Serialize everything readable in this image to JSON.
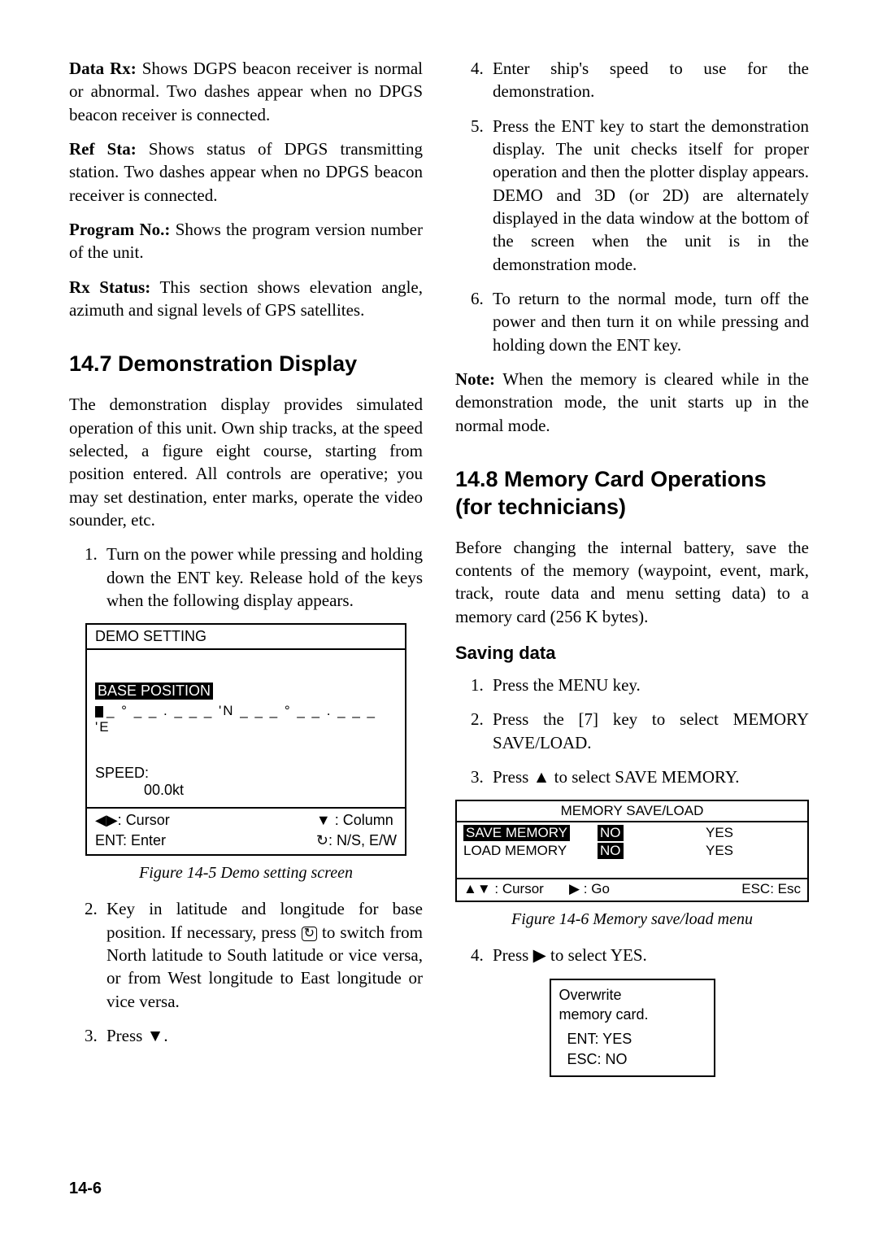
{
  "left": {
    "defs": [
      {
        "term": "Data Rx:",
        "text": " Shows DGPS beacon receiver is normal or abnormal. Two dashes appear when no DPGS beacon receiver is connected."
      },
      {
        "term": "Ref Sta:",
        "text": " Shows status of DPGS transmitting station. Two dashes appear when no DPGS beacon receiver is connected."
      },
      {
        "term": "Program No.:",
        "text": " Shows the program version number of the unit."
      },
      {
        "term": "Rx Status:",
        "text": " This section shows elevation angle, azimuth and signal levels of GPS satellites."
      }
    ],
    "section147": {
      "heading": "14.7 Demonstration Display",
      "intro": "The demonstration display provides simulated operation of this unit. Own ship tracks, at the speed selected, a figure eight course, starting from position entered. All controls are operative; you may set destination, enter marks, operate the video sounder, etc.",
      "steps": [
        "Turn on the power while pressing and holding down the ENT key. Release hold of the keys when the following display appears."
      ],
      "demoBox": {
        "title": "DEMO SETTING",
        "basePosLabel": "BASE POSITION",
        "posLine": "_ ° _ _ . _ _ _ 'N  _ _ _ ° _ _ . _ _ _ 'E",
        "speedLabel": "SPEED:",
        "speedValue": "00.0kt",
        "footer": {
          "leftTop": "◀▶: Cursor",
          "leftBottom": "ENT: Enter",
          "rightTop": "▼ : Column",
          "rightBottom": "↻: N/S, E/W"
        }
      },
      "figCaption": "Figure 14-5 Demo setting screen",
      "step2_a": "Key in latitude and longitude for base position. If necessary, press ",
      "step2_key": "↻",
      "step2_b": " to switch from North latitude to South latitude or vice versa, or from West longitude to East longitude or vice versa.",
      "step3": "Press ▼."
    }
  },
  "right": {
    "steps_cont": [
      "Enter ship's speed to use for the demonstration.",
      "Press the ENT key to start the demonstration display. The unit checks itself for proper operation and then the plotter display appears. DEMO and 3D (or 2D) are alternately displayed in the data window at the bottom of the screen when the unit is in the demonstration mode.",
      "To return to the normal mode, turn off the power and then turn it on while pressing and holding down the ENT key."
    ],
    "note": {
      "term": "Note:",
      "text": " When the memory is cleared while in the demonstration mode, the unit starts up in the normal mode."
    },
    "section148": {
      "heading": "14.8 Memory Card Operations (for technicians)",
      "intro": "Before changing the internal battery, save the contents of the memory (waypoint, event, mark, track, route data and menu setting data) to a memory card (256 K bytes).",
      "subheading": "Saving data",
      "steps": [
        "Press the MENU key.",
        "Press the [7] key to select MEMORY SAVE/LOAD.",
        "Press ▲ to select SAVE MEMORY."
      ],
      "memBox": {
        "title": "MEMORY SAVE/LOAD",
        "row1": {
          "label": "SAVE MEMORY",
          "opt1": "NO",
          "opt2": "YES"
        },
        "row2": {
          "label": "LOAD MEMORY",
          "opt1": "NO",
          "opt2": "YES"
        },
        "footer": {
          "c1": "▲▼ : Cursor",
          "c2": "▶ : Go",
          "c3": "ESC: Esc"
        }
      },
      "figCaption": "Figure 14-6 Memory save/load menu",
      "step4": "Press ▶ to select YES.",
      "overBox": {
        "line1": "Overwrite",
        "line2": "memory card.",
        "ent": "ENT: YES",
        "esc": "ESC: NO"
      }
    }
  },
  "pageNum": "14-6"
}
